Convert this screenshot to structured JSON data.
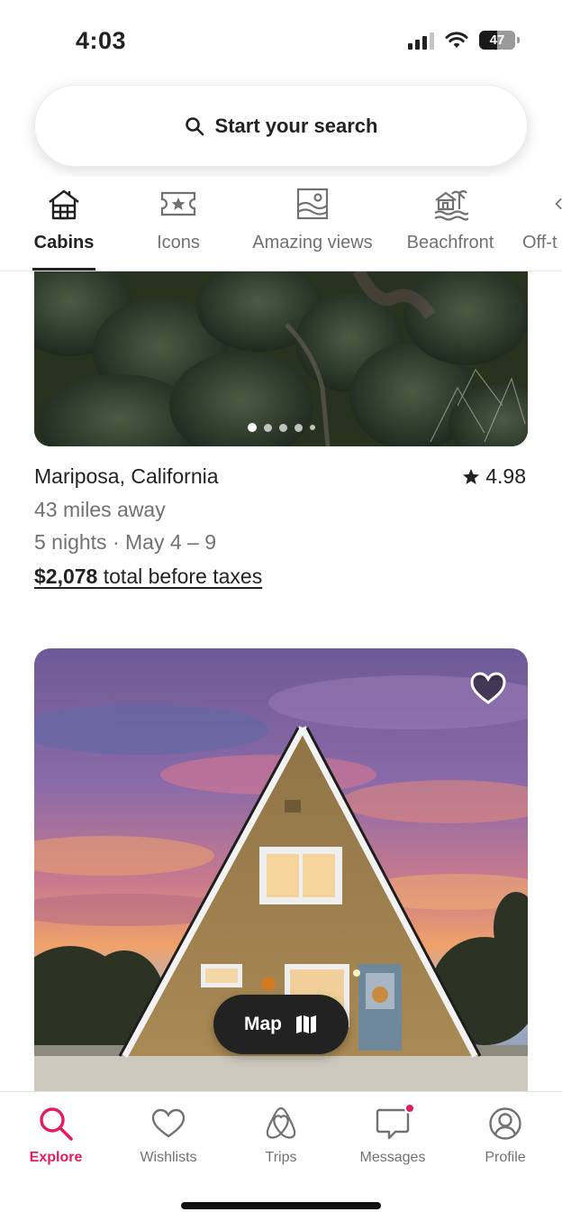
{
  "status_bar": {
    "time": "4:03",
    "battery": "47"
  },
  "search": {
    "label": "Start your search"
  },
  "categories": [
    {
      "label": "Cabins",
      "icon": "cabin-icon",
      "active": true
    },
    {
      "label": "Icons",
      "icon": "ticket-star-icon",
      "active": false
    },
    {
      "label": "Amazing views",
      "icon": "framed-landscape-icon",
      "active": false
    },
    {
      "label": "Beachfront",
      "icon": "beach-house-icon",
      "active": false
    },
    {
      "label": "Off-t",
      "icon": "partial-icon",
      "active": false
    }
  ],
  "listing1": {
    "title": "Mariposa, California",
    "rating": "4.98",
    "distance": "43 miles away",
    "dates": "5 nights · May 4 – 9",
    "price": "$2,078",
    "price_suffix": " total before taxes",
    "photo_dots": 5,
    "active_dot": 0
  },
  "listing2": {
    "wishlist_icon": "heart-outline-icon"
  },
  "map_button": {
    "label": "Map"
  },
  "bottom_nav": [
    {
      "label": "Explore",
      "icon": "search-icon",
      "active": true
    },
    {
      "label": "Wishlists",
      "icon": "heart-icon",
      "active": false
    },
    {
      "label": "Trips",
      "icon": "airbnb-logo-icon",
      "active": false
    },
    {
      "label": "Messages",
      "icon": "chat-bubble-icon",
      "active": false,
      "badge": true
    },
    {
      "label": "Profile",
      "icon": "user-circle-icon",
      "active": false
    }
  ],
  "colors": {
    "accent": "#e31c5f",
    "text": "#222222",
    "muted": "#717171"
  }
}
